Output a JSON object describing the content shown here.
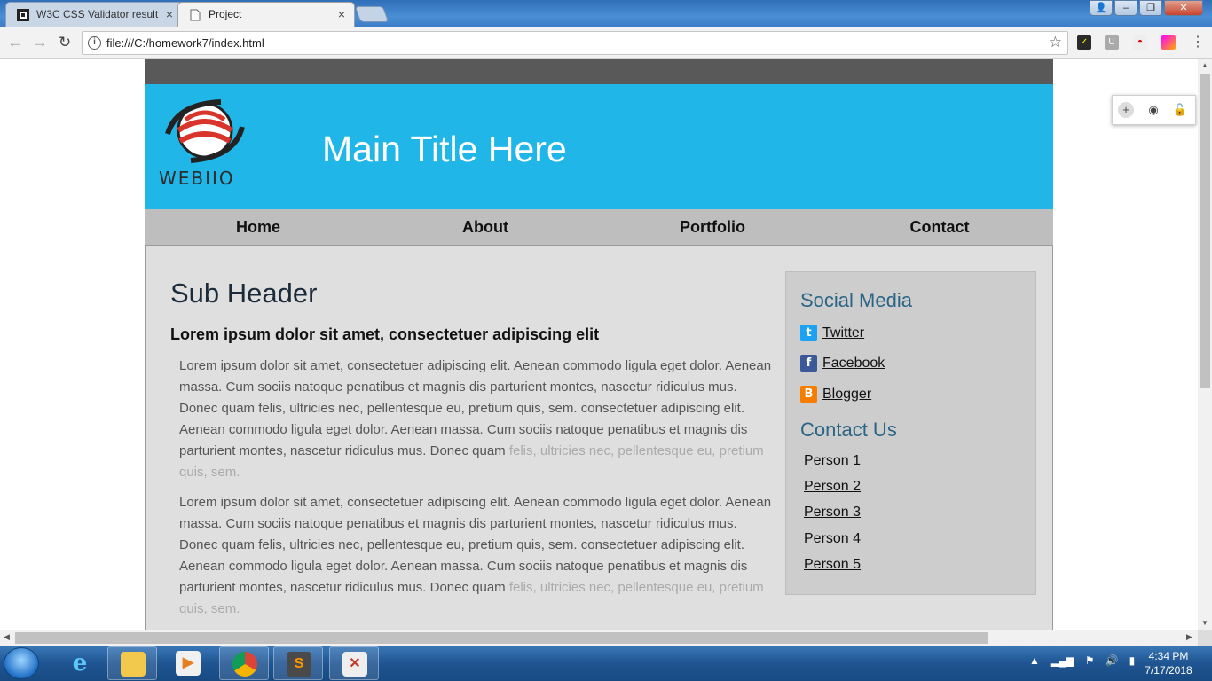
{
  "browser": {
    "tabs": [
      {
        "title": "W3C CSS Validator result",
        "active": false
      },
      {
        "title": "Project",
        "active": true
      }
    ],
    "close_glyph": "×",
    "url": "file:///C:/homework7/index.html",
    "window_buttons": [
      "–",
      "❐",
      "✕"
    ]
  },
  "site": {
    "logo_text": "WEBIIO",
    "main_title": "Main Title Here",
    "nav": [
      "Home",
      "About",
      "Portfolio",
      "Contact"
    ],
    "sub_header": "Sub Header",
    "bold_line": "Lorem ipsum dolor sit amet, consectetuer adipiscing elit",
    "paragraph_main": "Lorem ipsum dolor sit amet, consectetuer adipiscing elit. Aenean commodo ligula eget dolor. Aenean massa. Cum sociis natoque penatibus et magnis dis parturient montes, nascetur ridiculus mus. Donec quam felis, ultricies nec, pellentesque eu, pretium quis, sem. consectetuer adipiscing elit. Aenean commodo ligula eget dolor. Aenean massa. Cum sociis natoque penatibus et magnis dis parturient montes, nascetur ridiculus mus. Donec quam",
    "paragraph_fade": "felis, ultricies nec, pellentesque eu, pretium quis, sem.",
    "sidebar": {
      "social_heading": "Social Media",
      "social_links": [
        {
          "label": "Twitter",
          "icon": "twitter-icon",
          "color": "#1da1f2",
          "glyph": "t"
        },
        {
          "label": "Facebook",
          "icon": "facebook-icon",
          "color": "#3b5998",
          "glyph": "f"
        },
        {
          "label": "Blogger",
          "icon": "blogger-icon",
          "color": "#f57d00",
          "glyph": "B"
        }
      ],
      "contact_heading": "Contact Us",
      "persons": [
        "Person 1",
        "Person 2",
        "Person 3",
        "Person 4",
        "Person 5"
      ]
    }
  },
  "taskbar": {
    "time": "4:34 PM",
    "date": "7/17/2018"
  },
  "colors": {
    "header_bg": "#21b6e8",
    "topbar_bg": "#5a5959",
    "nav_bg": "#bebebe",
    "content_bg": "#e0dfdf",
    "sidebar_bg": "#cdcdcd",
    "sidebar_heading": "#2b6586"
  }
}
